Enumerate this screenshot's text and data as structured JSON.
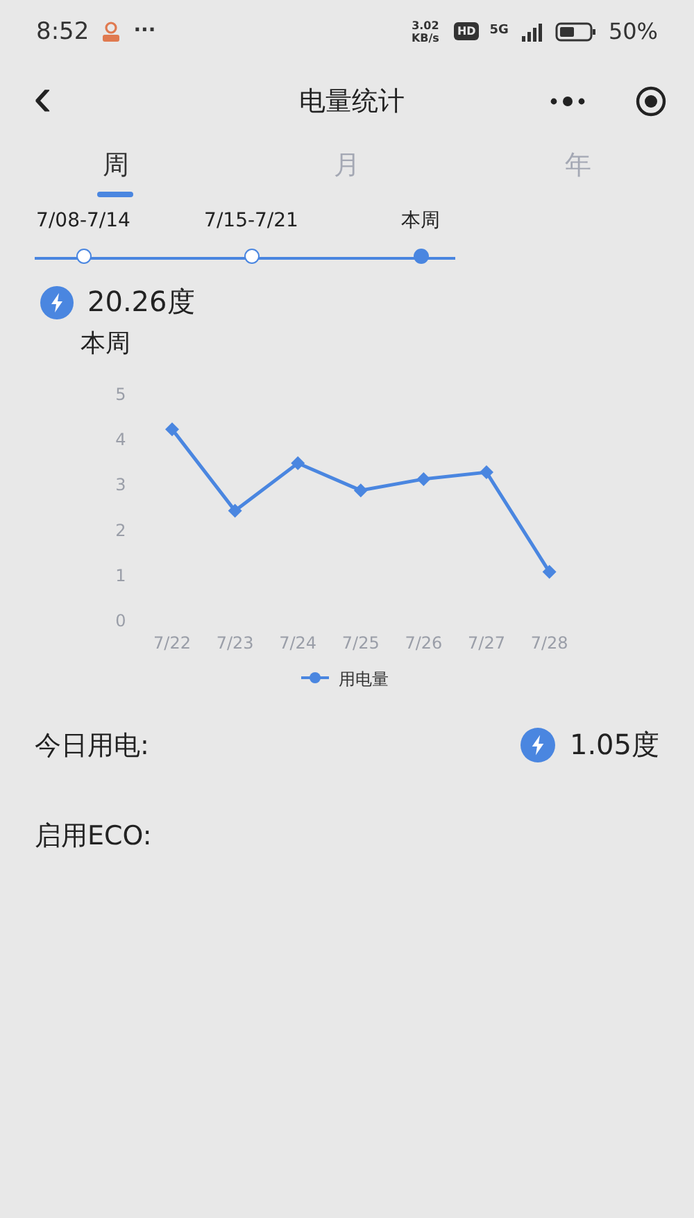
{
  "status_bar": {
    "time": "8:52",
    "more": "···",
    "speed": "3.02 KB/s",
    "hd": "HD",
    "network": "5G",
    "battery": "50%"
  },
  "nav": {
    "title": "电量统计",
    "back": "‹"
  },
  "tabs": [
    {
      "label": "周",
      "selected": true
    },
    {
      "label": "月",
      "selected": false
    },
    {
      "label": "年",
      "selected": false
    }
  ],
  "timeline": [
    {
      "label": "7/08-7/14",
      "selected": false
    },
    {
      "label": "7/15-7/21",
      "selected": false
    },
    {
      "label": "本周",
      "selected": true
    }
  ],
  "summary": {
    "value": "20.26度",
    "period": "本周"
  },
  "chart": {
    "chart_data": {
      "type": "line",
      "categories": [
        "7/22",
        "7/23",
        "7/24",
        "7/25",
        "7/26",
        "7/27",
        "7/28"
      ],
      "series": [
        {
          "name": "用电量",
          "color": "#4a86e0",
          "marker": "diamond",
          "values": [
            4.2,
            2.4,
            3.45,
            2.85,
            3.1,
            3.25,
            1.05
          ]
        }
      ],
      "ylim": [
        0,
        5
      ],
      "yticks": [
        0,
        1,
        2,
        3,
        4,
        5
      ]
    }
  },
  "rows": [
    {
      "label": "今日用电:",
      "value": "1.05度"
    },
    {
      "label": "启用ECO:"
    }
  ]
}
